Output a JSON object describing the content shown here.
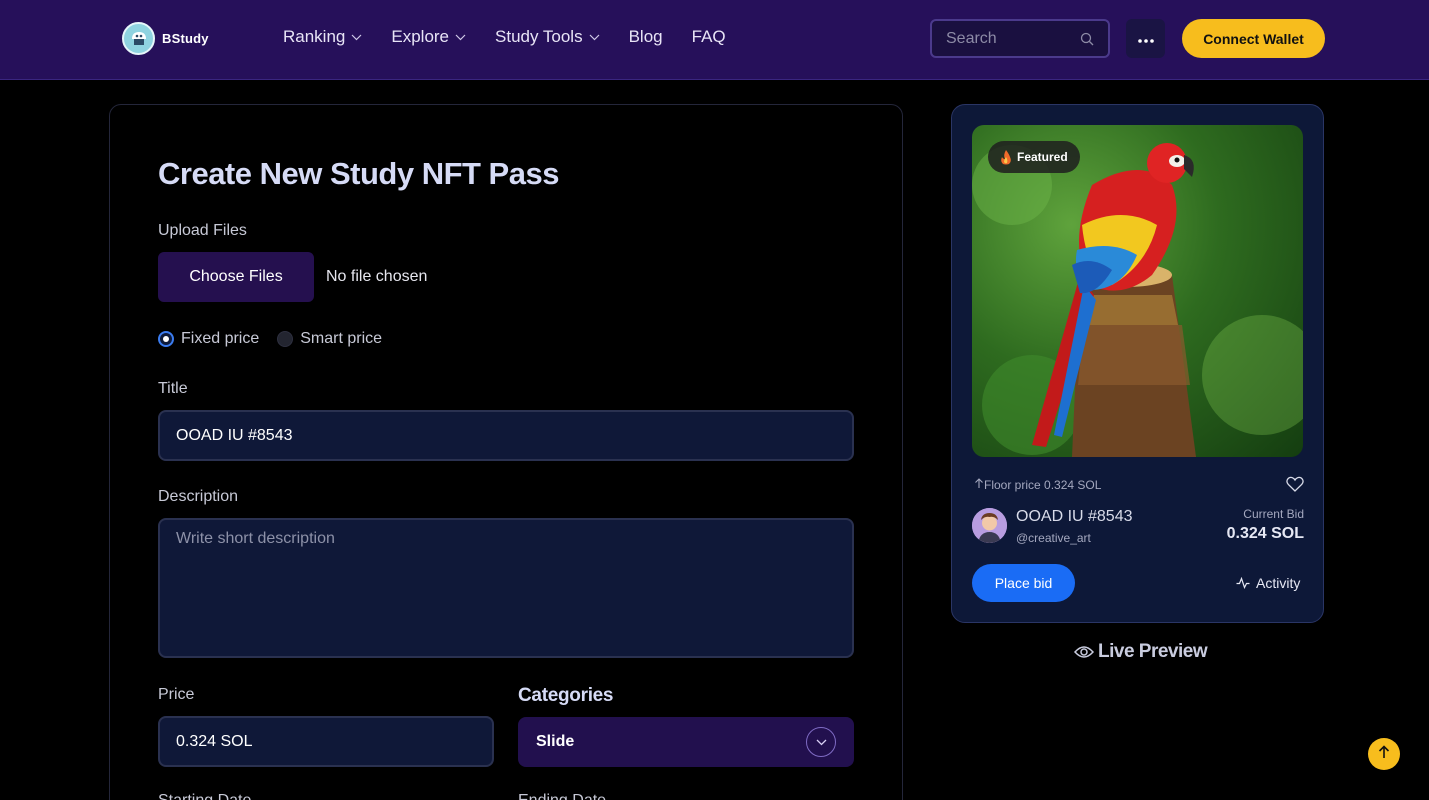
{
  "brand": {
    "name": "BStudy"
  },
  "nav": {
    "items": [
      {
        "label": "Ranking",
        "has_dropdown": true
      },
      {
        "label": "Explore",
        "has_dropdown": true
      },
      {
        "label": "Study Tools",
        "has_dropdown": true
      },
      {
        "label": "Blog",
        "has_dropdown": false
      },
      {
        "label": "FAQ",
        "has_dropdown": false
      }
    ]
  },
  "search": {
    "placeholder": "Search"
  },
  "header": {
    "connect_label": "Connect Wallet"
  },
  "form": {
    "title": "Create New Study NFT Pass",
    "upload_label": "Upload Files",
    "choose_files_label": "Choose Files",
    "file_status": "No file chosen",
    "price_options": [
      {
        "label": "Fixed price",
        "selected": true
      },
      {
        "label": "Smart price",
        "selected": false
      }
    ],
    "title_label": "Title",
    "title_value": "OOAD IU #8543",
    "description_label": "Description",
    "description_placeholder": "Write short description",
    "price_label": "Price",
    "price_value": "0.324 SOL",
    "categories_label": "Categories",
    "category_value": "Slide",
    "starting_date_label": "Starting Date",
    "ending_date_label": "Ending Date"
  },
  "preview": {
    "badge": "Featured",
    "floor_price": "Floor price 0.324 SOL",
    "nft_name": "OOAD IU #8543",
    "handle": "@creative_art",
    "current_bid_label": "Current Bid",
    "current_bid_value": "0.324 SOL",
    "place_bid_label": "Place bid",
    "activity_label": "Activity",
    "live_preview_label": "Live Preview"
  },
  "colors": {
    "header_bg": "#26105a",
    "accent_yellow": "#f7bd1d",
    "button_blue": "#1a6cf5",
    "field_bg": "#0f1838",
    "card_bg": "#0d1838"
  }
}
